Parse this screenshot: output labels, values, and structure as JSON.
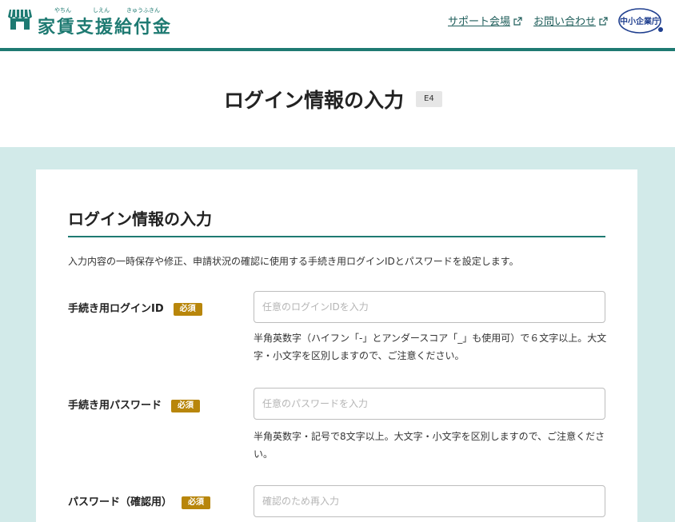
{
  "header": {
    "logo_text": "家賃支援給付金",
    "logo_ruby": [
      "やちん",
      "しえん",
      "きゅうふきん"
    ],
    "support_link": "サポート会場",
    "contact_link": "お問い合わせ",
    "agency_logo": "中小企業庁"
  },
  "page": {
    "title": "ログイン情報の入力",
    "code": "E4"
  },
  "form": {
    "section_title": "ログイン情報の入力",
    "intro": "入力内容の一時保存や修正、申請状況の確認に使用する手続き用ログインIDとパスワードを設定します。",
    "required_label": "必須",
    "fields": [
      {
        "label": "手続き用ログインID",
        "placeholder": "任意のログインIDを入力",
        "hint": "半角英数字（ハイフン「-」とアンダースコア「_」も使用可）で６文字以上。大文字・小文字を区別しますので、ご注意ください。"
      },
      {
        "label": "手続き用パスワード",
        "placeholder": "任意のパスワードを入力",
        "hint": "半角英数字・記号で8文字以上。大文字・小文字を区別しますので、ご注意ください。"
      },
      {
        "label": "パスワード（確認用）",
        "placeholder": "確認のため再入力",
        "hint": ""
      }
    ]
  },
  "colors": {
    "brand": "#1e7a72",
    "page_bg": "#d2eae9",
    "required_badge": "#b8860b"
  }
}
